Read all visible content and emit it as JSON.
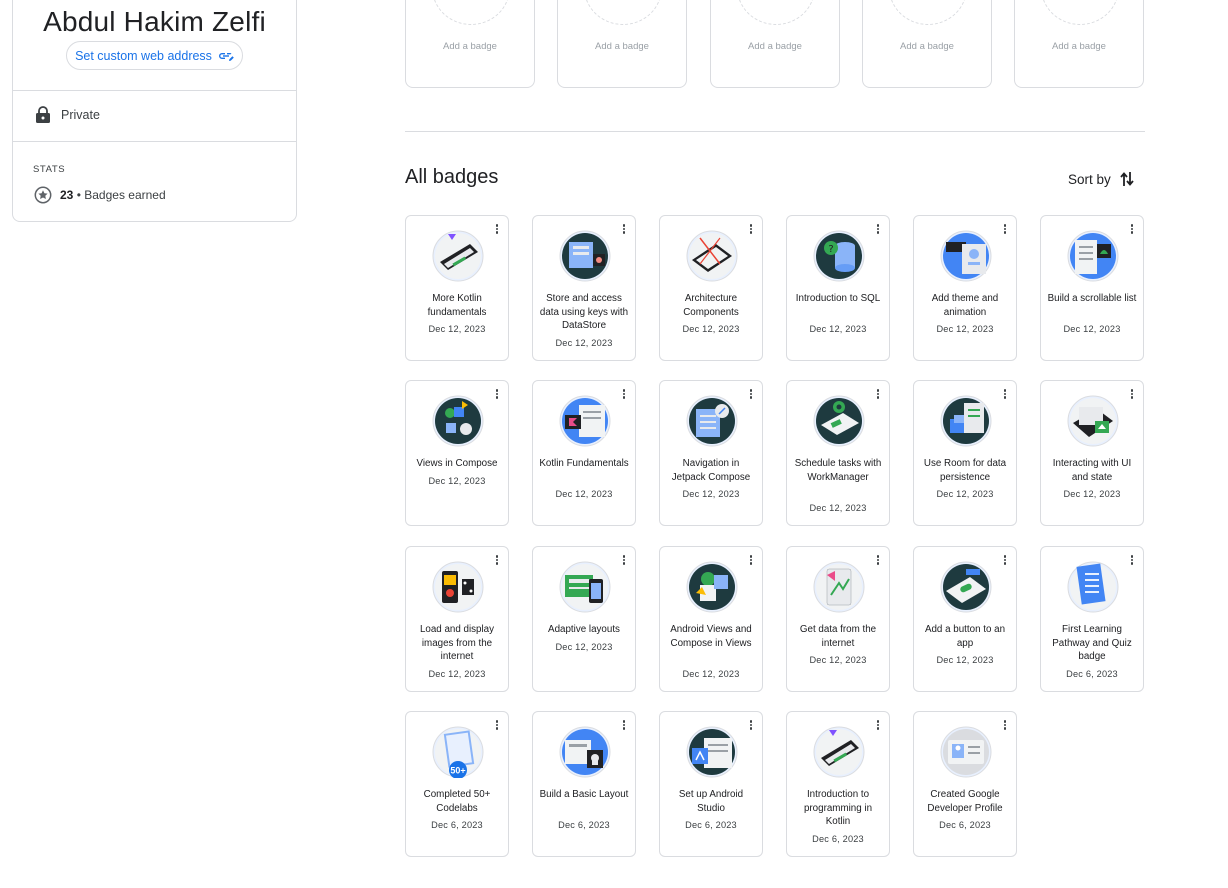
{
  "profile": {
    "name": "Abdul Hakim Zelfi",
    "custom_address_label": "Set custom web address",
    "privacy_label": "Private",
    "stats_heading": "STATS",
    "badges_count": "23",
    "badges_earned_label": "• Badges earned"
  },
  "featured_slots": [
    {
      "label": "Add a badge"
    },
    {
      "label": "Add a badge"
    },
    {
      "label": "Add a badge"
    },
    {
      "label": "Add a badge"
    },
    {
      "label": "Add a badge"
    }
  ],
  "all_badges": {
    "title": "All badges",
    "sort_label": "Sort by"
  },
  "badges": [
    {
      "title": "More Kotlin fundamentals",
      "date": "Dec 12, 2023",
      "icon": "kotlin-laptop-icon"
    },
    {
      "title": "Store and access data using keys with DataStore",
      "date": "Dec 12, 2023",
      "icon": "datastore-icon"
    },
    {
      "title": "Architecture Components",
      "date": "Dec 12, 2023",
      "icon": "architecture-icon"
    },
    {
      "title": "Introduction to SQL",
      "date": "Dec 12, 2023",
      "icon": "sql-database-icon"
    },
    {
      "title": "Add theme and animation",
      "date": "Dec 12, 2023",
      "icon": "theme-animation-icon"
    },
    {
      "title": "Build a scrollable list",
      "date": "Dec 12, 2023",
      "icon": "scrollable-list-icon"
    },
    {
      "title": "Views in Compose",
      "date": "Dec 12, 2023",
      "icon": "views-compose-icon"
    },
    {
      "title": "Kotlin Fundamentals",
      "date": "Dec 12, 2023",
      "icon": "kotlin-fundamentals-icon"
    },
    {
      "title": "Navigation in Jetpack Compose",
      "date": "Dec 12, 2023",
      "icon": "navigation-icon"
    },
    {
      "title": "Schedule tasks with WorkManager",
      "date": "Dec 12, 2023",
      "icon": "workmanager-icon"
    },
    {
      "title": "Use Room for data persistence",
      "date": "Dec 12, 2023",
      "icon": "room-icon"
    },
    {
      "title": "Interacting with UI and state",
      "date": "Dec 12, 2023",
      "icon": "ui-state-icon"
    },
    {
      "title": "Load and display images from the internet",
      "date": "Dec 12, 2023",
      "icon": "images-internet-icon"
    },
    {
      "title": "Adaptive layouts",
      "date": "Dec 12, 2023",
      "icon": "adaptive-layouts-icon"
    },
    {
      "title": "Android Views and Compose in Views",
      "date": "Dec 12, 2023",
      "icon": "android-views-icon"
    },
    {
      "title": "Get data from the internet",
      "date": "Dec 12, 2023",
      "icon": "get-data-icon"
    },
    {
      "title": "Add a button to an app",
      "date": "Dec 12, 2023",
      "icon": "add-button-icon"
    },
    {
      "title": "First Learning Pathway and Quiz badge",
      "date": "Dec 6, 2023",
      "icon": "quiz-badge-icon"
    },
    {
      "title": "Completed 50+ Codelabs",
      "date": "Dec 6, 2023",
      "icon": "codelabs-50-icon",
      "badge_text": "50+"
    },
    {
      "title": "Build a Basic Layout",
      "date": "Dec 6, 2023",
      "icon": "basic-layout-icon"
    },
    {
      "title": "Set up Android Studio",
      "date": "Dec 6, 2023",
      "icon": "android-studio-icon"
    },
    {
      "title": "Introduction to programming in Kotlin",
      "date": "Dec 6, 2023",
      "icon": "intro-kotlin-icon"
    },
    {
      "title": "Created Google Developer Profile",
      "date": "Dec 6, 2023",
      "icon": "developer-profile-icon"
    }
  ]
}
